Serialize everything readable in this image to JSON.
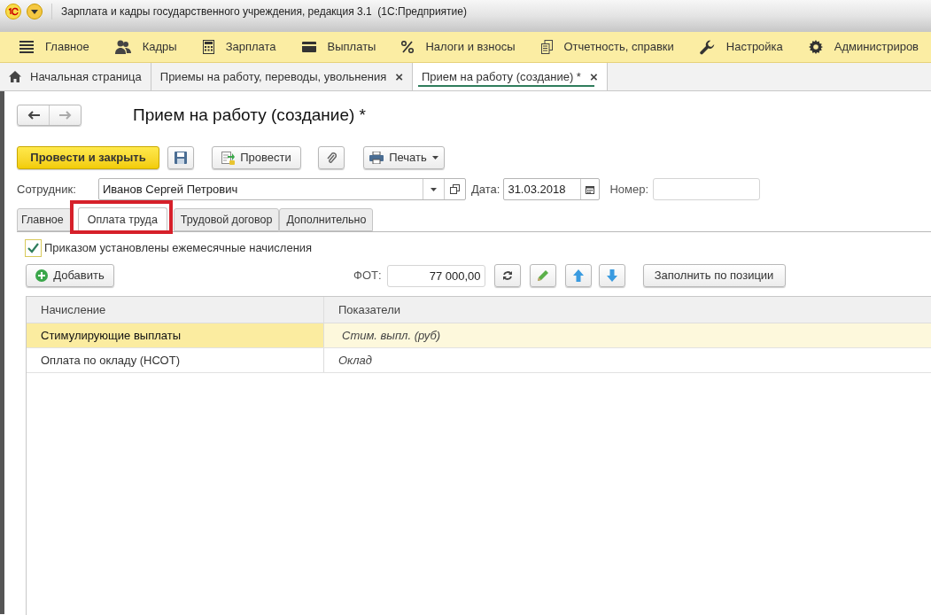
{
  "window": {
    "title": "Зарплата и кадры государственного учреждения, редакция 3.1  (1С:Предприятие)"
  },
  "menu": [
    {
      "label": "Главное"
    },
    {
      "label": "Кадры"
    },
    {
      "label": "Зарплата"
    },
    {
      "label": "Выплаты"
    },
    {
      "label": "Налоги и взносы"
    },
    {
      "label": "Отчетность, справки"
    },
    {
      "label": "Настройка"
    },
    {
      "label": "Администриров"
    }
  ],
  "open_tabs": [
    {
      "label": "Начальная страница",
      "kind": "home",
      "selected": false
    },
    {
      "label": "Приемы на работу, переводы, увольнения",
      "kind": "closable",
      "selected": false
    },
    {
      "label": "Прием на работу (создание) *",
      "kind": "closable",
      "selected": true
    }
  ],
  "close_glyph": "×",
  "form": {
    "title": "Прием на работу (создание) *",
    "toolbar": {
      "post_close": "Провести и закрыть",
      "post": "Провести",
      "print": "Печать"
    },
    "employee": {
      "label": "Сотрудник:",
      "value": "Иванов Сергей Петрович"
    },
    "date": {
      "label": "Дата:",
      "value": "31.03.2018"
    },
    "number": {
      "label": "Номер:"
    },
    "tabs": [
      {
        "label": "Главное",
        "selected": false
      },
      {
        "label": "Оплата труда",
        "selected": true
      },
      {
        "label": "Трудовой договор",
        "selected": false
      },
      {
        "label": "Дополнительно",
        "selected": false
      }
    ],
    "monthly_accruals": {
      "label": "Приказом установлены ежемесячные начисления",
      "checked": true
    },
    "add_button": "Добавить",
    "fot": {
      "label": "ФОТ:",
      "value": "77 000,00"
    },
    "fill_button": "Заполнить по позиции",
    "table": {
      "columns": [
        "Начисление",
        "Показатели"
      ],
      "rows": [
        {
          "cells": [
            "Стимулирующие выплаты",
            "Стим. выпл. (руб)"
          ],
          "selected": true
        },
        {
          "cells": [
            "Оплата по окладу (НСОТ)",
            "Оклад"
          ],
          "selected": false
        }
      ]
    }
  }
}
